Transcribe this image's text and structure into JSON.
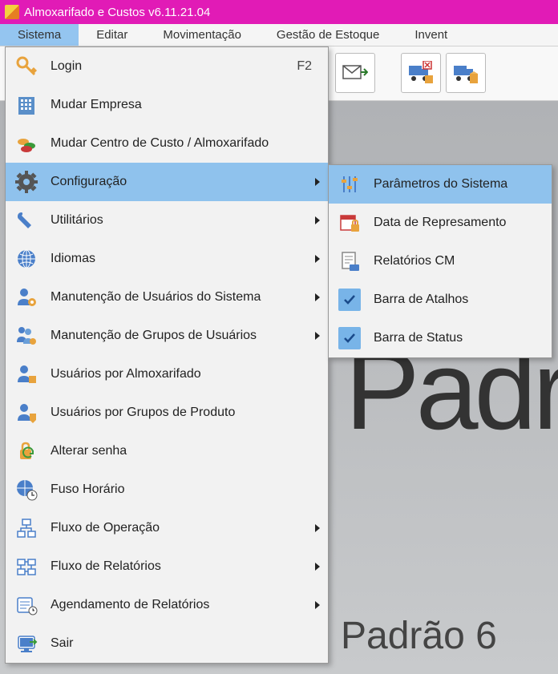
{
  "window": {
    "title": "Almoxarifado e Custos v6.11.21.04"
  },
  "menubar": {
    "items": [
      {
        "label": "Sistema",
        "active": true
      },
      {
        "label": "Editar"
      },
      {
        "label": "Movimentação"
      },
      {
        "label": "Gestão de Estoque"
      },
      {
        "label": "Invent"
      }
    ]
  },
  "background": {
    "big_text": "Padr",
    "small_text": "Padrão 6"
  },
  "dropdown": {
    "items": [
      {
        "icon": "key",
        "label": "Login",
        "shortcut": "F2"
      },
      {
        "icon": "building",
        "label": "Mudar Empresa"
      },
      {
        "icon": "coins",
        "label": "Mudar Centro de Custo / Almoxarifado"
      },
      {
        "icon": "gear",
        "label": "Configuração",
        "submenu": true,
        "highlight": true
      },
      {
        "icon": "wrench",
        "label": "Utilitários",
        "submenu": true
      },
      {
        "icon": "globe",
        "label": "Idiomas",
        "submenu": true
      },
      {
        "icon": "user-gear",
        "label": "Manutenção de Usuários do Sistema",
        "submenu": true
      },
      {
        "icon": "users-gear",
        "label": "Manutenção de Grupos de Usuários",
        "submenu": true
      },
      {
        "icon": "user-box",
        "label": "Usuários por Almoxarifado"
      },
      {
        "icon": "user-tag",
        "label": "Usuários por Grupos de Produto"
      },
      {
        "icon": "lock-cycle",
        "label": "Alterar senha"
      },
      {
        "icon": "globe-time",
        "label": "Fuso Horário"
      },
      {
        "icon": "flow",
        "label": "Fluxo de Operação",
        "submenu": true
      },
      {
        "icon": "flow-report",
        "label": "Fluxo de Relatórios",
        "submenu": true
      },
      {
        "icon": "schedule",
        "label": "Agendamento de Relatórios",
        "submenu": true
      },
      {
        "icon": "exit",
        "label": "Sair"
      }
    ]
  },
  "submenu": {
    "items": [
      {
        "icon": "sliders",
        "label": "Parâmetros do Sistema",
        "highlight": true
      },
      {
        "icon": "calendar-lock",
        "label": "Data de Represamento"
      },
      {
        "icon": "report",
        "label": "Relatórios CM"
      },
      {
        "icon": "check",
        "label": "Barra de Atalhos",
        "checked": true
      },
      {
        "icon": "check",
        "label": "Barra de Status",
        "checked": true
      }
    ]
  }
}
